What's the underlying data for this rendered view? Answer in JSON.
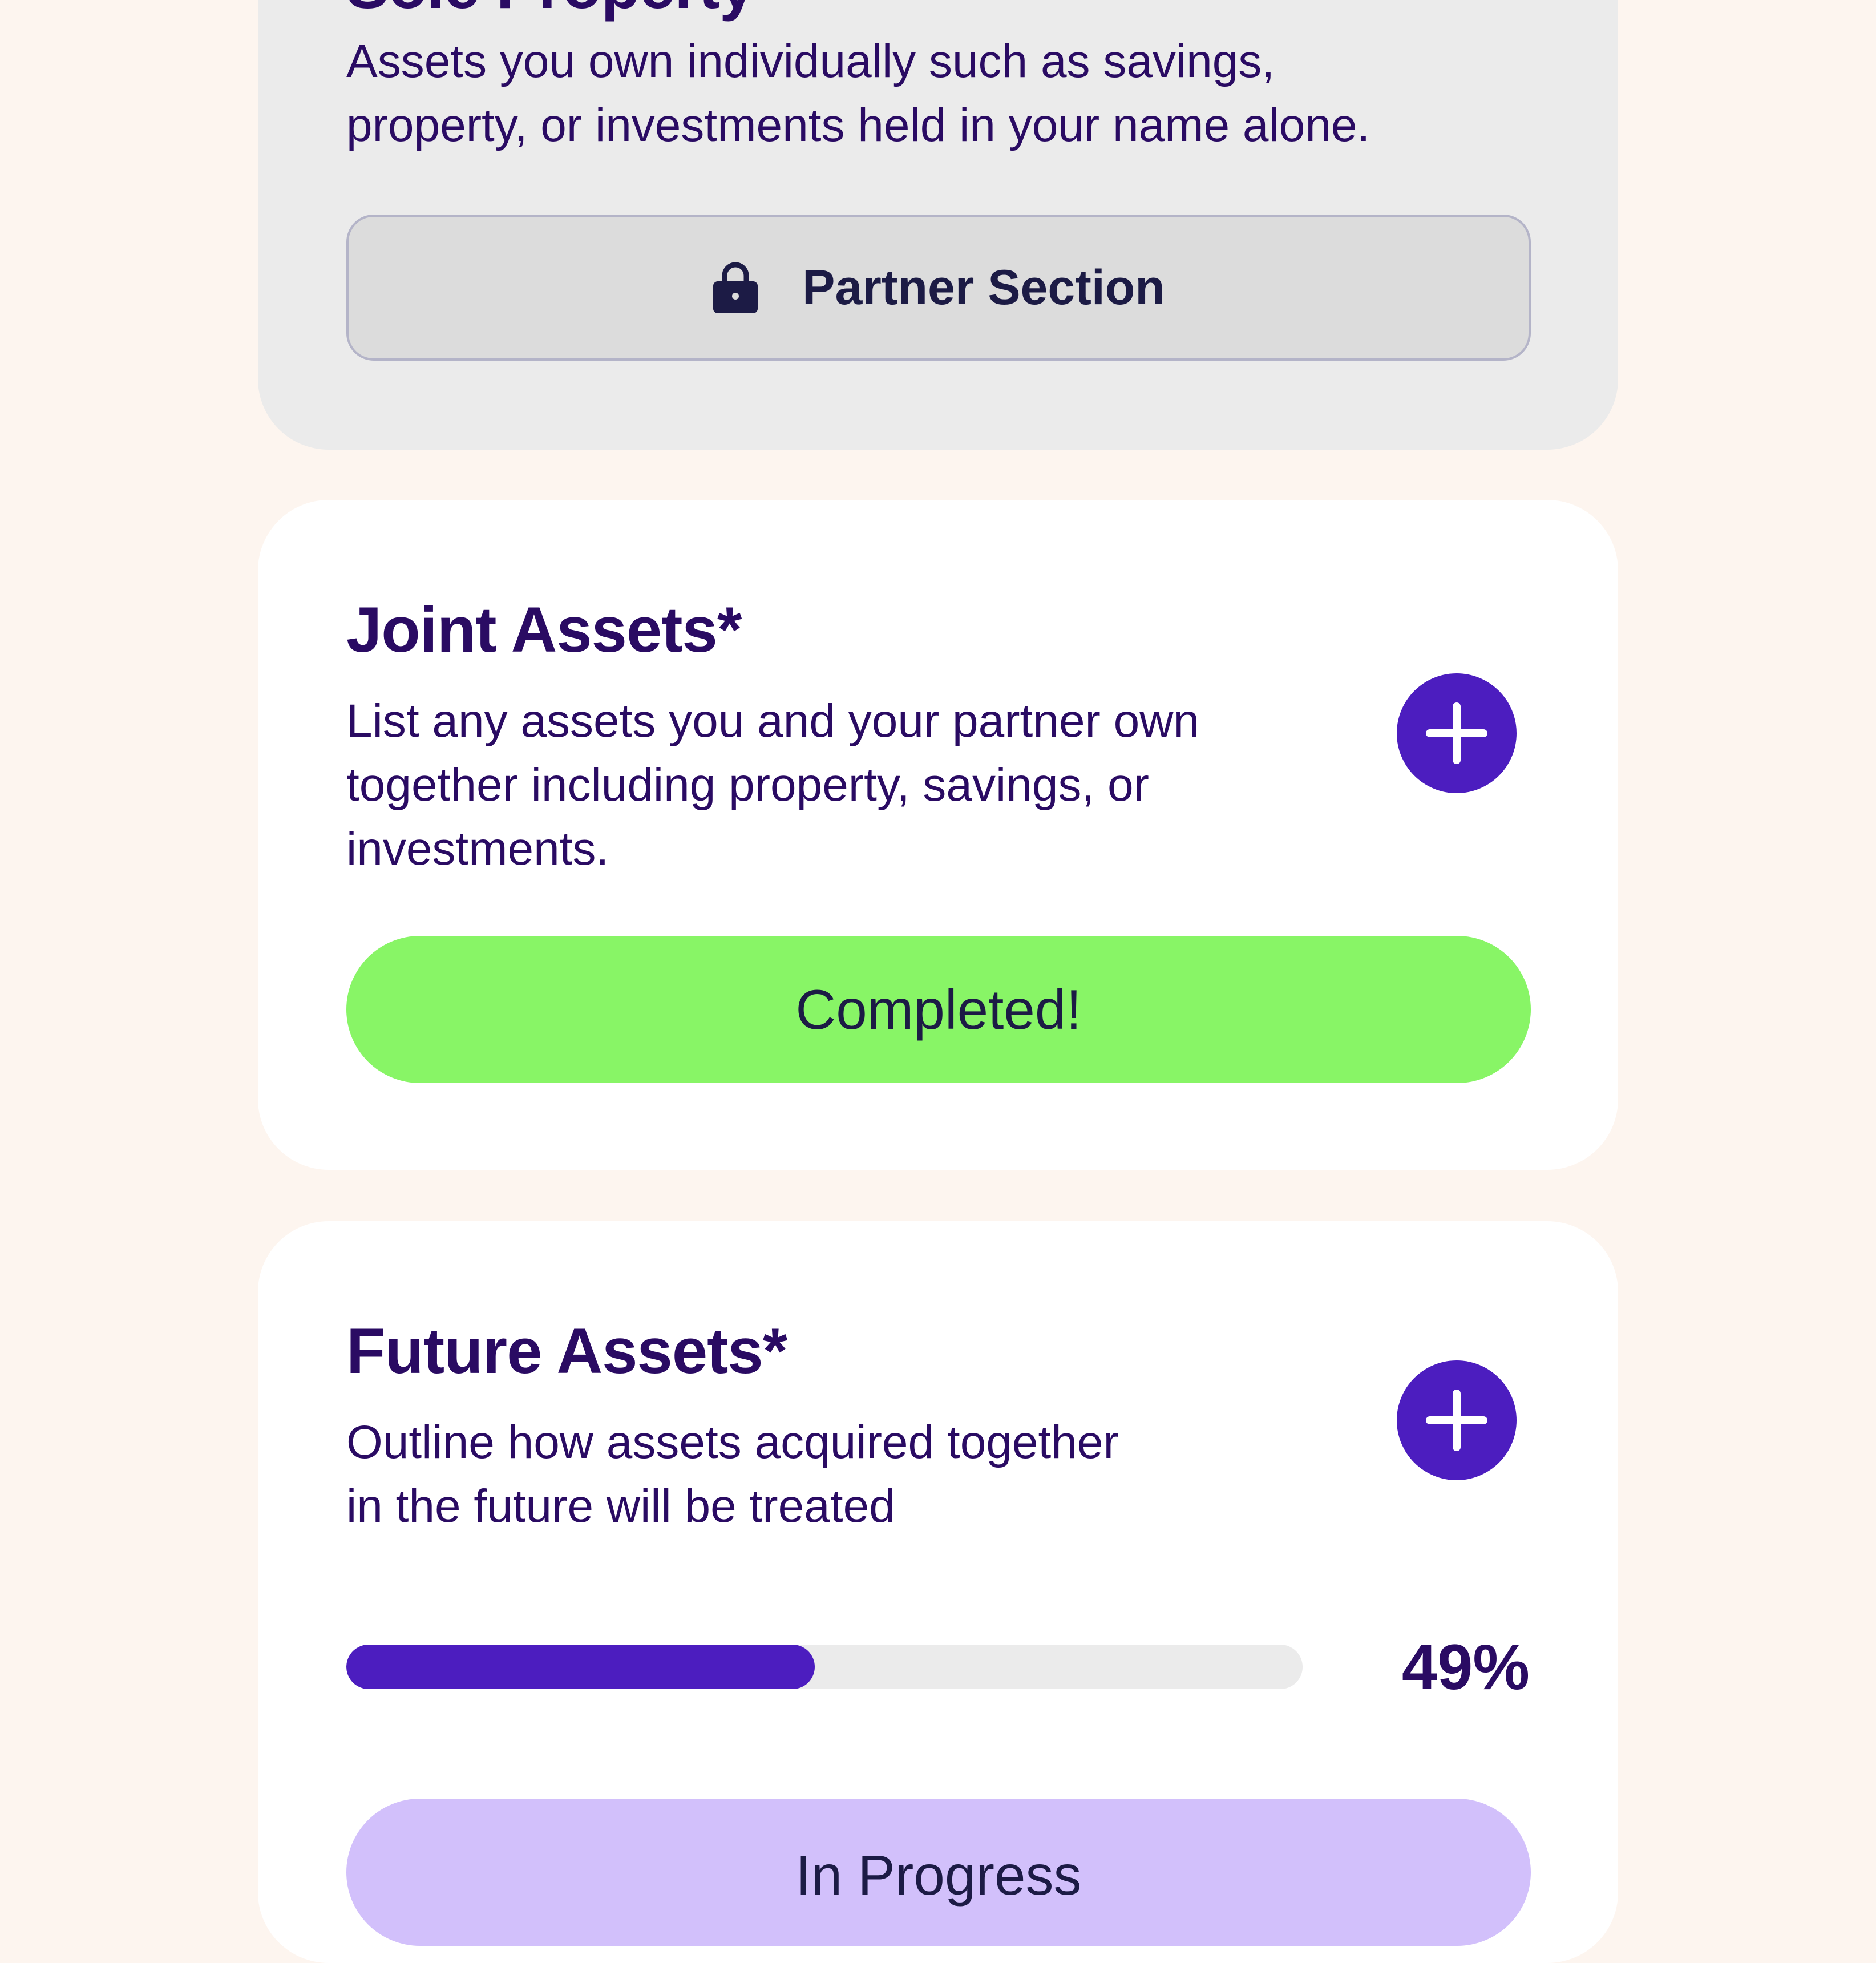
{
  "colors": {
    "background": "#fdf5ef",
    "accent": "#4c1dbf",
    "text": "#2a0b63",
    "completed": "#88f566",
    "in_progress": "#d2c0fb",
    "locked_card": "#ebebeb"
  },
  "sole_card": {
    "title": "Sole Property*",
    "description_lines": [
      "Assets you own individually such as savings,",
      "property, or investments held in your name alone."
    ],
    "button_label": "Partner Section",
    "button_icon": "lock-icon"
  },
  "joint_card": {
    "title": "Joint Assets*",
    "description_lines": [
      "List any assets you and your partner own",
      "together including property, savings, or",
      "investments."
    ],
    "add_icon": "plus-icon",
    "status_label": "Completed!"
  },
  "future_card": {
    "title": "Future Assets*",
    "description_lines": [
      "Outline how assets acquired together",
      "in the future will be treated"
    ],
    "add_icon": "plus-icon",
    "progress_fraction": 0.49,
    "progress_label": "49%",
    "status_label": "In Progress"
  }
}
